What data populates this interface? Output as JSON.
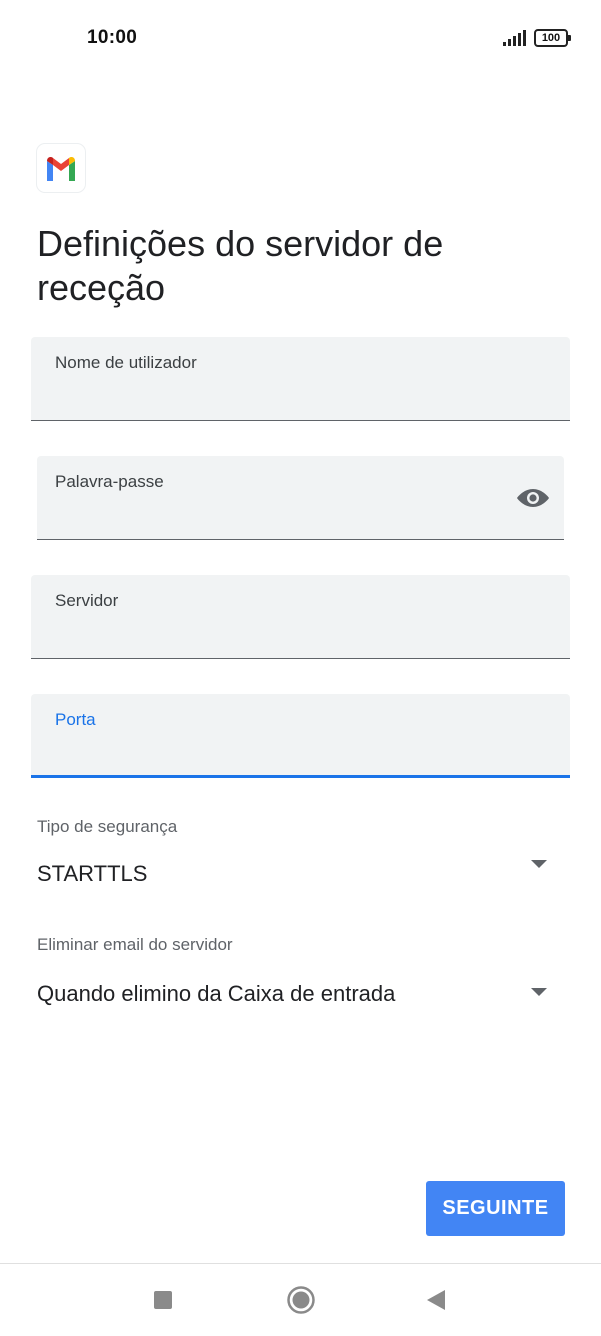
{
  "status_bar": {
    "time": "10:00",
    "battery": "100"
  },
  "app": {
    "logo_icon": "gmail-icon"
  },
  "page": {
    "title": "Definições do servidor de receção"
  },
  "fields": {
    "username": {
      "label": "Nome de utilizador",
      "value": ""
    },
    "password": {
      "label": "Palavra-passe",
      "value": "",
      "toggle_icon": "eye-icon"
    },
    "server": {
      "label": "Servidor",
      "value": ""
    },
    "port": {
      "label": "Porta",
      "value": ""
    }
  },
  "security": {
    "label": "Tipo de segurança",
    "selected": "STARTTLS"
  },
  "delete_email": {
    "label": "Eliminar email do servidor",
    "selected": "Quando elimino da Caixa de entrada"
  },
  "actions": {
    "next_label": "SEGUINTE"
  },
  "colors": {
    "accent": "#1a73e8",
    "button": "#4285f4",
    "field_bg": "#f1f3f4"
  }
}
